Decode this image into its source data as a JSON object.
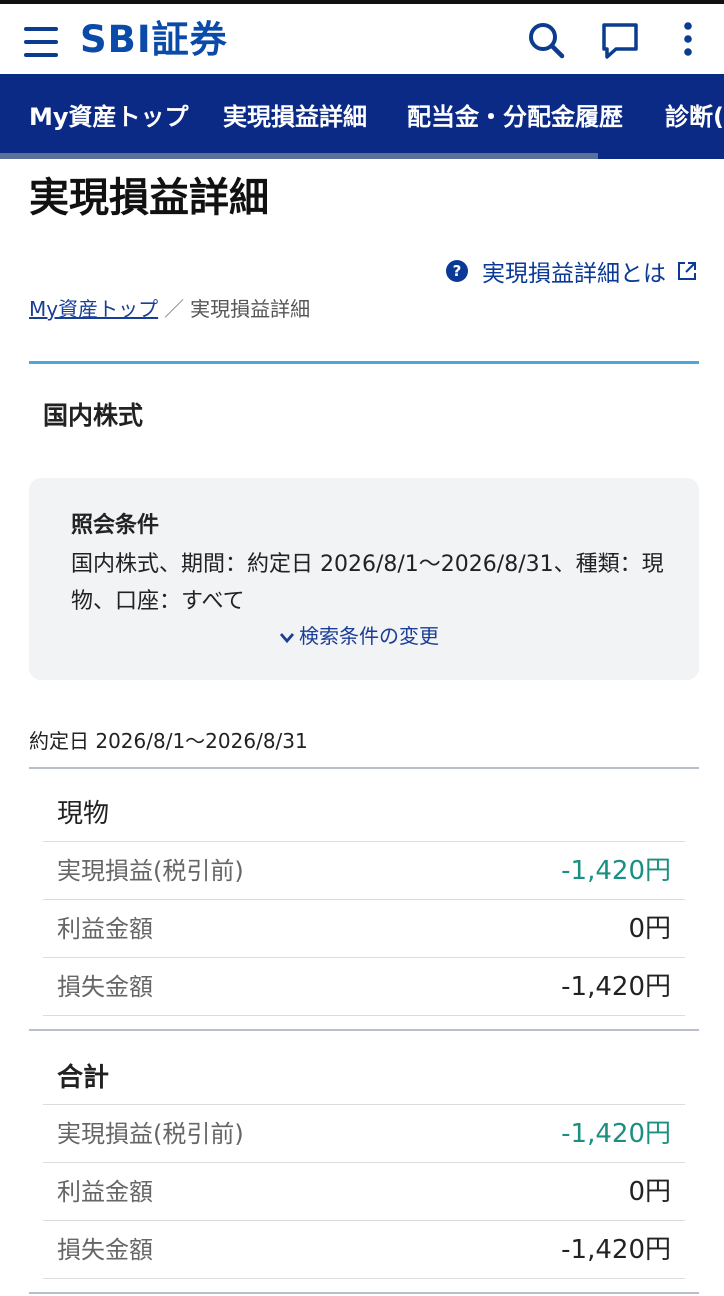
{
  "header": {
    "logo": "SBI証券",
    "menu_icon": "hamburger-menu-icon",
    "search_icon": "search-icon",
    "chat_icon": "chat-bubble-icon",
    "more_icon": "more-vertical-icon"
  },
  "nav": {
    "tabs": [
      {
        "label": "My資産トップ"
      },
      {
        "label": "実現損益詳細"
      },
      {
        "label": "配当金・分配金履歴"
      },
      {
        "label": "診断("
      }
    ]
  },
  "page": {
    "title": "実現損益詳細",
    "help_link": "実現損益詳細とは",
    "help_icon": "question-circle-icon",
    "external_icon": "external-link-icon"
  },
  "breadcrumb": {
    "home": "My資産トップ",
    "separator": "／",
    "current": "実現損益詳細"
  },
  "section": {
    "title": "国内株式"
  },
  "conditions": {
    "label": "照会条件",
    "text": "国内株式、期間：約定日 2026/8/1〜2026/8/31、種類：現物、口座：すべて",
    "change_label": "検索条件の変更",
    "change_icon": "chevron-down-icon"
  },
  "period": "約定日 2026/8/1〜2026/8/31",
  "groups": [
    {
      "title": "現物",
      "rows": [
        {
          "label": "実現損益(税引前)",
          "value": "-1,420円"
        },
        {
          "label": "利益金額",
          "value": "0円"
        },
        {
          "label": "損失金額",
          "value": "-1,420円"
        }
      ]
    },
    {
      "title": "合計",
      "rows": [
        {
          "label": "実現損益(税引前)",
          "value": "-1,420円"
        },
        {
          "label": "利益金額",
          "value": "0円"
        },
        {
          "label": "損失金額",
          "value": "-1,420円"
        }
      ]
    }
  ],
  "colors": {
    "brand": "#0a4aa8",
    "nav_bg": "#0a2a86",
    "accent_rule": "#4aa8db",
    "pl_value": "#1a8f82"
  }
}
